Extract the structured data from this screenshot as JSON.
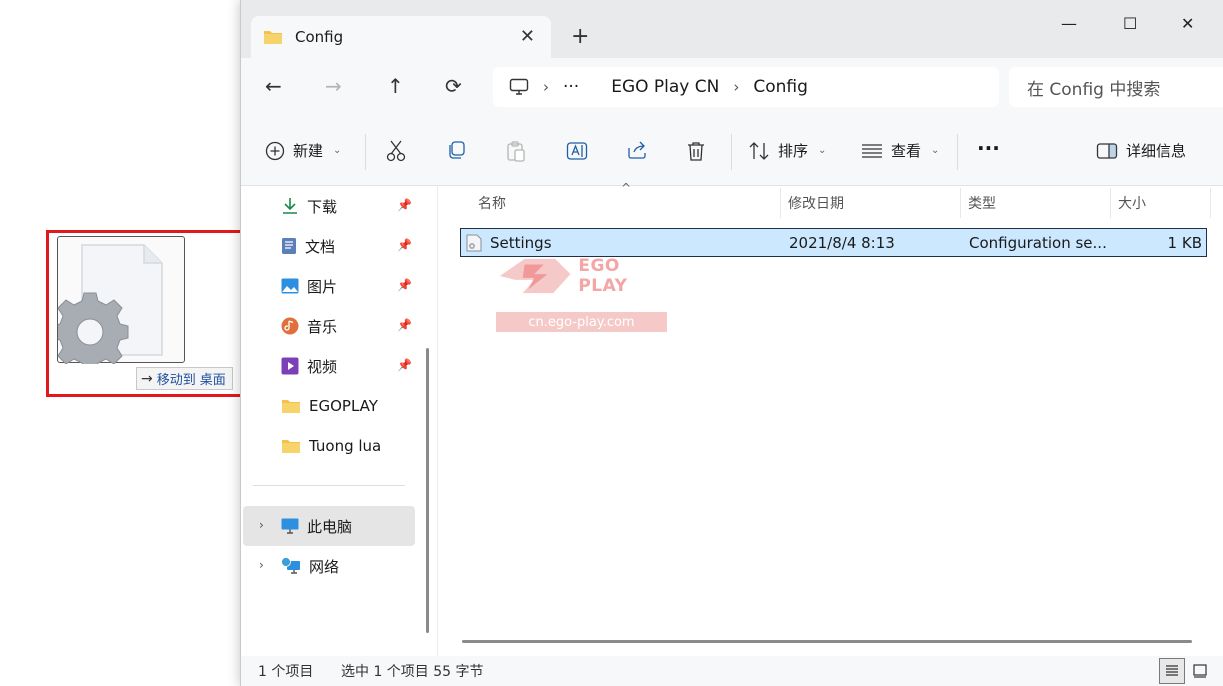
{
  "drag": {
    "tooltip_action": "移动到",
    "tooltip_target": "桌面"
  },
  "window": {
    "tab_title": "Config",
    "tab_close": "✕",
    "new_tab": "+",
    "minimize": "—",
    "maximize": "☐",
    "close": "✕"
  },
  "nav": {
    "back": "←",
    "forward": "→",
    "up": "↑",
    "refresh": "⟳",
    "breadcrumb": [
      "EGO Play CN",
      "Config"
    ],
    "more": "···",
    "search_placeholder": "在 Config 中搜索"
  },
  "toolbar": {
    "new_label": "新建",
    "sort_label": "排序",
    "view_label": "查看",
    "more": "···",
    "details_label": "详细信息"
  },
  "sidebar": {
    "items": [
      {
        "label": "下载",
        "icon": "download-icon",
        "pinned": true
      },
      {
        "label": "文档",
        "icon": "document-icon",
        "pinned": true
      },
      {
        "label": "图片",
        "icon": "pictures-icon",
        "pinned": true
      },
      {
        "label": "音乐",
        "icon": "music-icon",
        "pinned": true
      },
      {
        "label": "视频",
        "icon": "video-icon",
        "pinned": true
      },
      {
        "label": "EGOPLAY",
        "icon": "folder-icon",
        "pinned": false
      },
      {
        "label": "Tuong lua",
        "icon": "folder-icon",
        "pinned": false
      }
    ],
    "this_pc": "此电脑",
    "network": "网络"
  },
  "columns": {
    "name": "名称",
    "modified": "修改日期",
    "type": "类型",
    "size": "大小"
  },
  "files": [
    {
      "name": "Settings",
      "modified": "2021/8/4 8:13",
      "type": "Configuration se...",
      "size": "1 KB"
    }
  ],
  "watermark": {
    "brand": "EGO PLAY",
    "url": "cn.ego-play.com"
  },
  "status": {
    "item_count": "1 个项目",
    "selection": "选中 1 个项目  55 字节"
  },
  "colors": {
    "accent_selection": "#cce8ff",
    "drag_highlight": "#e0191a",
    "folder": "#f2c14e"
  }
}
